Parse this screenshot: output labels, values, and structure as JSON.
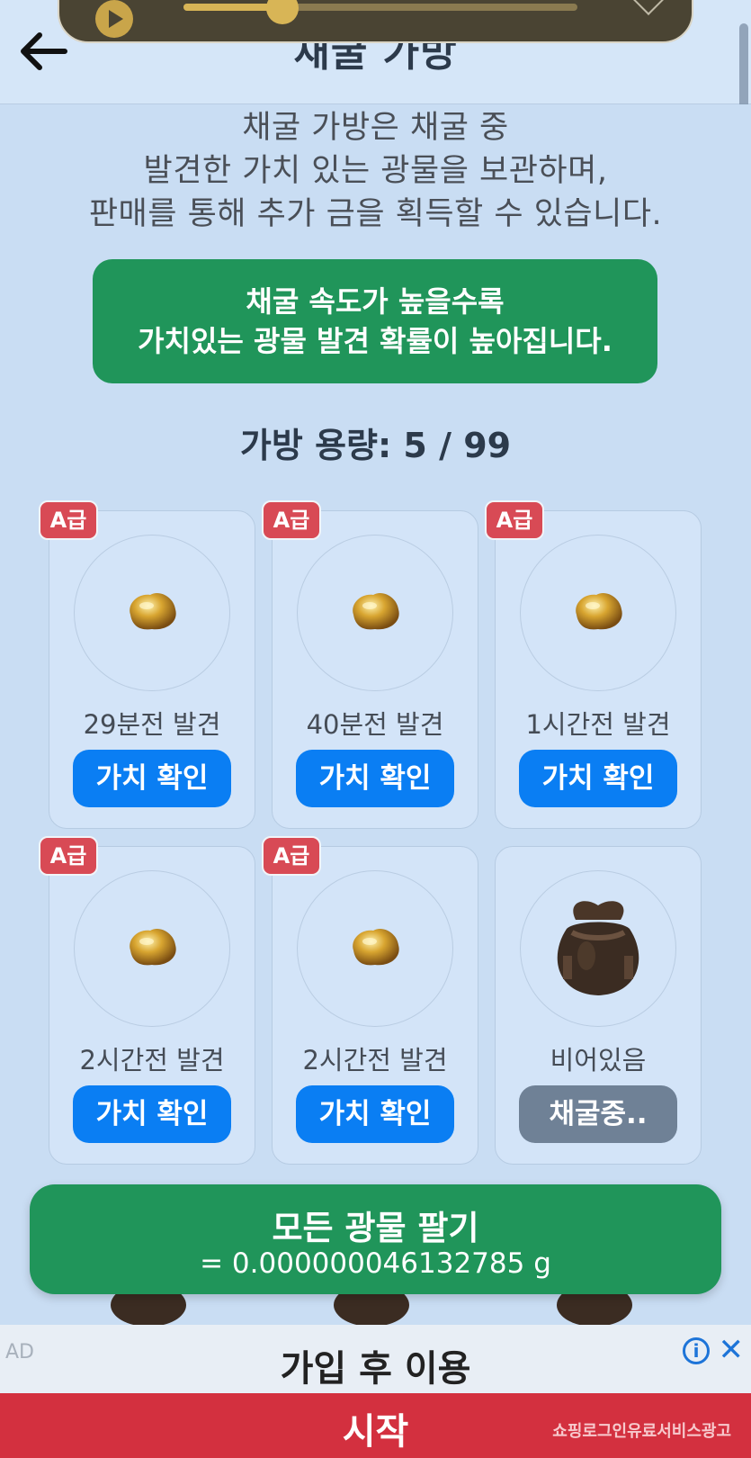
{
  "header": {
    "title": "채굴 가방"
  },
  "media": {
    "progress": 0.25
  },
  "intro": {
    "lines": [
      "채굴 가방은 채굴 중",
      "발견한 가치 있는 광물을 보관하며,",
      "판매를 통해 추가 금을 획득할 수 있습니다."
    ]
  },
  "notice": {
    "line1": "채굴 속도가 높을수록",
    "line2": "가치있는 광물 발견 확률이 높아집니다."
  },
  "bag": {
    "capacity_label": "가방 용량: 5 / 99"
  },
  "items": [
    {
      "badge": "A급",
      "found": "29분전 발견",
      "button": "가치 확인",
      "icon": "gold-nugget-icon"
    },
    {
      "badge": "A급",
      "found": "40분전 발견",
      "button": "가치 확인",
      "icon": "gold-nugget-icon"
    },
    {
      "badge": "A급",
      "found": "1시간전 발견",
      "button": "가치 확인",
      "icon": "gold-nugget-icon"
    },
    {
      "badge": "A급",
      "found": "2시간전 발견",
      "button": "가치 확인",
      "icon": "gold-nugget-icon"
    },
    {
      "badge": "A급",
      "found": "2시간전 발견",
      "button": "가치 확인",
      "icon": "gold-nugget-icon"
    },
    {
      "badge": "",
      "found": "비어있음",
      "button": "채굴중..",
      "icon": "sack-icon"
    }
  ],
  "sell_all": {
    "label": "모든 광물 팔기",
    "value": "= 0.000000046132785 g"
  },
  "ad": {
    "label": "AD",
    "title": "가입 후 이용",
    "cta": "시작",
    "sub": "쇼핑로그인유료서비스광고",
    "info": "i",
    "close": "✕"
  },
  "colors": {
    "accent_green": "#20955a",
    "button_blue": "#0a7ef3",
    "badge_red": "#d84a55",
    "ad_red": "#d3303f"
  }
}
